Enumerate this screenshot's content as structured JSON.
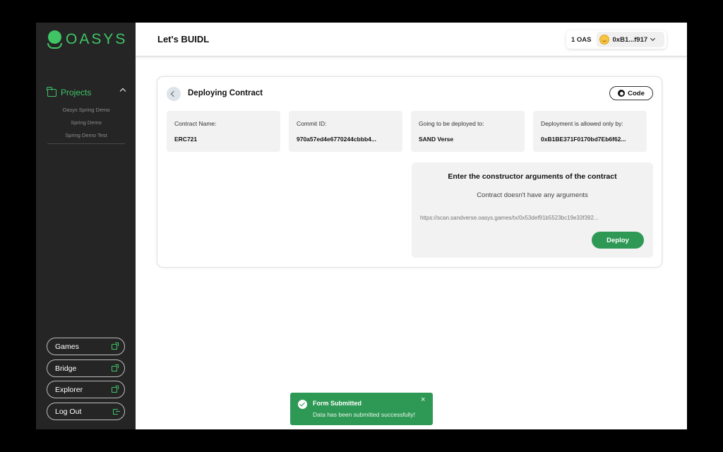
{
  "brand": {
    "name": "OASYS",
    "color": "#3fc566"
  },
  "sidebar": {
    "projects_label": "Projects",
    "projects": [
      "Oasys Spring Demo",
      "Spring Demo",
      "Spring Demo Test"
    ],
    "buttons": {
      "games": "Games",
      "bridge": "Bridge",
      "explorer": "Explorer",
      "logout": "Log Out"
    }
  },
  "header": {
    "title": "Let's BUIDL",
    "balance": "1 OAS",
    "address": "0xB1...f917"
  },
  "deploy": {
    "title": "Deploying Contract",
    "code_label": "Code",
    "info": [
      {
        "label": "Contract Name:",
        "value": "ERC721"
      },
      {
        "label": "Commit ID:",
        "value": "970a57ed4e6770244cbbb4..."
      },
      {
        "label": "Going to be deployed to:",
        "value": "SAND Verse"
      },
      {
        "label": "Deployment is allowed only by:",
        "value": "0xB1BE371F0170bd7Eb6f62..."
      }
    ],
    "args_title": "Enter the constructor arguments of the contract",
    "args_subtitle": "Contract doesn't have any arguments",
    "tx_link": "https://scan.sandverse.oasys.games/tx/0x53def91b5523bc19e33f392...",
    "deploy_label": "Deploy",
    "accent": "#2e9954"
  },
  "toast": {
    "title": "Form Submitted",
    "message": "Data has been submitted successfully!",
    "close": "×"
  }
}
